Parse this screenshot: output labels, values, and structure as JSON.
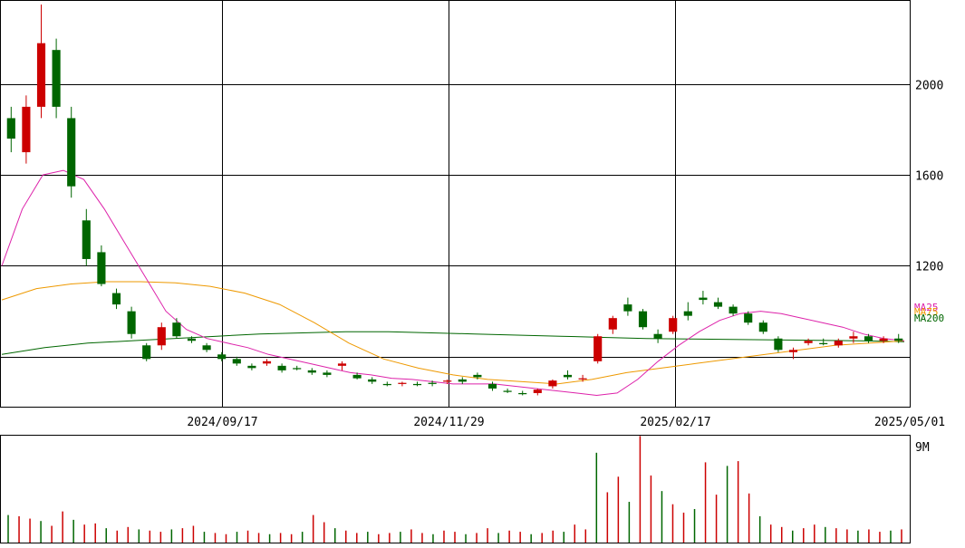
{
  "chart_data": [
    {
      "type": "candlestick",
      "title": "",
      "x_ticks": [
        "2024/09/17",
        "2024/11/29",
        "2025/02/17",
        "2025/05/01"
      ],
      "y_ticks": [
        2000,
        1600,
        1200
      ],
      "ylim": [
        580,
        2370
      ],
      "grid": true,
      "legend": [
        "MA25",
        "MA75",
        "MA200"
      ],
      "colors": {
        "up": "#cc0000",
        "down": "#006600",
        "ma25": "#dd22aa",
        "ma75": "#ee9900",
        "ma200": "#006600"
      },
      "ohlc_sampled": [
        [
          1850,
          1900,
          1700,
          1760
        ],
        [
          1700,
          1950,
          1650,
          1900
        ],
        [
          1900,
          2350,
          1850,
          2180
        ],
        [
          2150,
          2200,
          1850,
          1900
        ],
        [
          1850,
          1900,
          1500,
          1550
        ],
        [
          1400,
          1450,
          1200,
          1230
        ],
        [
          1260,
          1290,
          1110,
          1120
        ],
        [
          1080,
          1100,
          1010,
          1030
        ],
        [
          1000,
          1020,
          880,
          900
        ],
        [
          850,
          860,
          780,
          790
        ],
        [
          850,
          950,
          830,
          930
        ],
        [
          950,
          970,
          880,
          890
        ],
        [
          880,
          890,
          860,
          870
        ],
        [
          850,
          860,
          820,
          830
        ],
        [
          810,
          820,
          780,
          790
        ],
        [
          790,
          800,
          760,
          770
        ],
        [
          760,
          770,
          740,
          750
        ],
        [
          770,
          790,
          760,
          780
        ],
        [
          760,
          770,
          730,
          740
        ],
        [
          750,
          760,
          740,
          745
        ],
        [
          740,
          750,
          720,
          730
        ],
        [
          730,
          740,
          710,
          720
        ],
        [
          760,
          780,
          740,
          770
        ],
        [
          720,
          730,
          700,
          705
        ],
        [
          700,
          710,
          680,
          690
        ],
        [
          680,
          690,
          670,
          675
        ],
        [
          680,
          690,
          670,
          685
        ],
        [
          680,
          690,
          670,
          675
        ],
        [
          685,
          695,
          670,
          680
        ],
        [
          690,
          700,
          680,
          695
        ],
        [
          700,
          710,
          680,
          690
        ],
        [
          720,
          730,
          700,
          710
        ],
        [
          680,
          690,
          650,
          660
        ],
        [
          650,
          660,
          640,
          645
        ],
        [
          640,
          650,
          630,
          635
        ],
        [
          640,
          660,
          630,
          655
        ],
        [
          670,
          700,
          660,
          695
        ],
        [
          720,
          740,
          700,
          710
        ],
        [
          700,
          720,
          690,
          705
        ],
        [
          780,
          900,
          770,
          890
        ],
        [
          920,
          980,
          900,
          970
        ],
        [
          1030,
          1060,
          980,
          1000
        ],
        [
          1000,
          1010,
          920,
          930
        ],
        [
          900,
          920,
          860,
          880
        ],
        [
          910,
          980,
          900,
          970
        ],
        [
          1000,
          1040,
          960,
          980
        ],
        [
          1060,
          1090,
          1030,
          1050
        ],
        [
          1040,
          1060,
          1010,
          1020
        ],
        [
          1020,
          1030,
          980,
          990
        ],
        [
          990,
          1000,
          940,
          950
        ],
        [
          950,
          960,
          900,
          910
        ],
        [
          880,
          890,
          820,
          830
        ],
        [
          820,
          840,
          790,
          830
        ],
        [
          860,
          880,
          850,
          870
        ],
        [
          860,
          880,
          850,
          855
        ],
        [
          850,
          880,
          840,
          870
        ],
        [
          880,
          910,
          860,
          890
        ],
        [
          890,
          900,
          860,
          870
        ],
        [
          870,
          890,
          860,
          880
        ],
        [
          880,
          900,
          860,
          870
        ]
      ],
      "ma25_sampled": [
        1200,
        1450,
        1600,
        1620,
        1580,
        1450,
        1300,
        1150,
        1000,
        920,
        880,
        860,
        840,
        810,
        790,
        770,
        750,
        730,
        720,
        705,
        700,
        690,
        680,
        680,
        680,
        670,
        660,
        650,
        640,
        630,
        640,
        700,
        780,
        850,
        910,
        960,
        990,
        1000,
        990,
        970,
        950,
        930,
        900,
        880,
        870
      ],
      "ma75_sampled": [
        1050,
        1100,
        1120,
        1130,
        1130,
        1125,
        1110,
        1080,
        1030,
        950,
        860,
        790,
        750,
        720,
        700,
        690,
        680,
        700,
        730,
        750,
        770,
        790,
        810,
        830,
        850,
        860,
        870
      ],
      "ma200_sampled": [
        810,
        840,
        860,
        870,
        880,
        890,
        900,
        905,
        910,
        910,
        905,
        900,
        895,
        890,
        885,
        880,
        878,
        876,
        874,
        872,
        870,
        866
      ]
    },
    {
      "type": "bar",
      "title": "",
      "y_ticks": [
        "9M"
      ],
      "ylim": [
        0,
        9000000
      ],
      "values_sampled": [
        2300000,
        2200000,
        2000000,
        1800000,
        1400000,
        2600000,
        1900000,
        1500000,
        1600000,
        1200000,
        1000000,
        1300000,
        1100000,
        1000000,
        900000,
        1100000,
        1200000,
        1400000,
        900000,
        800000,
        700000,
        900000,
        1000000,
        800000,
        700000,
        800000,
        700000,
        900000,
        2300000,
        1700000,
        1200000,
        1000000,
        800000,
        900000,
        700000,
        800000,
        900000,
        1100000,
        800000,
        700000,
        1000000,
        900000,
        700000,
        800000,
        1200000,
        800000,
        1000000,
        900000,
        700000,
        800000,
        1000000,
        900000,
        1500000,
        1100000,
        7500000,
        4200000,
        5500000,
        3400000,
        8900000,
        5600000,
        4300000,
        3200000,
        2500000,
        2800000,
        6700000,
        4000000,
        6400000,
        6800000,
        4100000,
        2200000,
        1500000,
        1300000,
        1000000,
        1200000,
        1500000,
        1300000,
        1200000,
        1100000,
        1000000,
        1100000,
        900000,
        1000000,
        1100000
      ]
    }
  ]
}
